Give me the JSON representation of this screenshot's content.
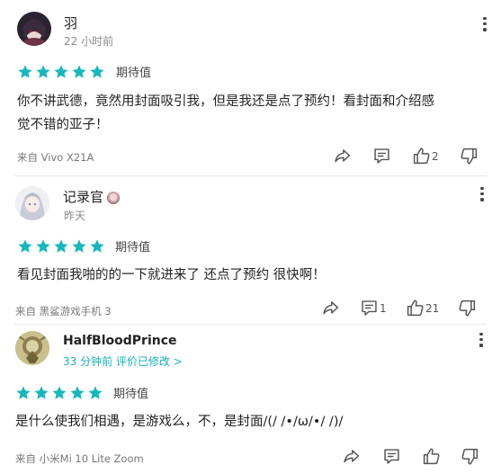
{
  "rating_label": "期待值",
  "reviews": [
    {
      "username": "羽",
      "time": "22 小时前",
      "rating": 5,
      "content_line1": "你不讲武德，竟然用封面吸引我，但是我还是点了预约！看封面和介绍感",
      "content_line2": "觉不错的亚子！",
      "device": "来自 Vivo X21A",
      "likes": "2",
      "comments": ""
    },
    {
      "username": "记录官",
      "time": "昨天",
      "rating": 5,
      "content_line1": "看见封面我啪的的一下就进来了 还点了预约 很快啊！",
      "device": "来自 黑鲨游戏手机 3",
      "likes": "21",
      "comments": "1"
    },
    {
      "username": "HalfBloodPrince",
      "time": "33 分钟前 评价已修改 >",
      "rating": 5,
      "content_line1": "是什么使我们相遇，是游戏么，不，是封面/(/ /•/ω/•/ /)/",
      "device": "来自 小米Mi 10 Lite Zoom",
      "likes": "",
      "comments": ""
    }
  ],
  "colors": {
    "star": "#14b8bd",
    "accent": "#14b3b8",
    "muted": "#8a8a8a"
  },
  "icons": [
    "share-icon",
    "comment-icon",
    "thumb-up-icon",
    "thumb-down-icon",
    "more-vertical-icon",
    "star-icon"
  ]
}
